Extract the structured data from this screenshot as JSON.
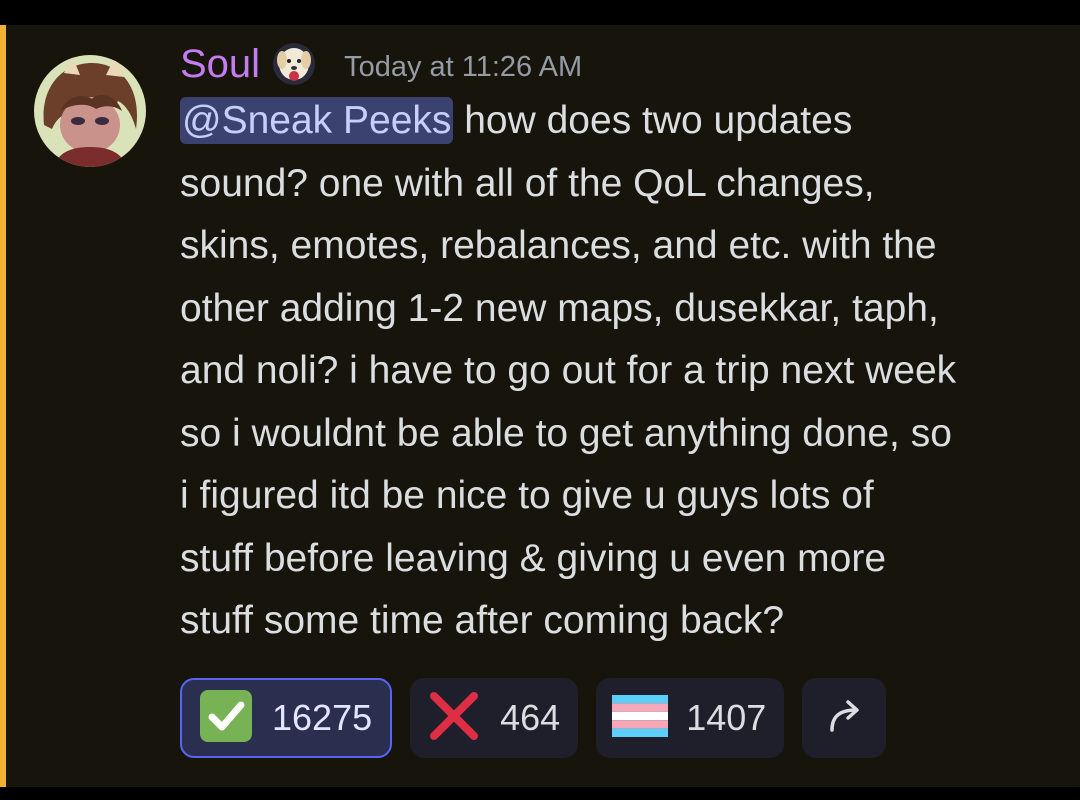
{
  "message": {
    "author": "Soul",
    "timestamp": "Today at 11:26 AM",
    "mention": "@Sneak Peeks",
    "lines": [
      " how does two updates",
      "sound? one with all of the QoL changes,",
      "skins, emotes, rebalances, and etc. with the",
      "other adding 1-2 new maps, dusekkar, taph,",
      "and noli? i have to go out for a trip next week",
      "so i wouldnt be able to get anything done, so",
      "i figured itd be nice to give u guys lots of",
      "stuff before leaving & giving u even more",
      "stuff some time after coming back?"
    ]
  },
  "reactions": [
    {
      "emoji": "white-check-mark-icon",
      "count": "16275",
      "selected": true
    },
    {
      "emoji": "x-mark-icon",
      "count": "464",
      "selected": false
    },
    {
      "emoji": "transgender-flag-icon",
      "count": "1407",
      "selected": false
    }
  ],
  "colors": {
    "username": "#c57cf0",
    "mention_bg": "#3c4270",
    "highlight_bar": "#f0b232",
    "message_bg": "#17140c",
    "selected_reaction_border": "#5865f2"
  },
  "icons": {
    "role_icon": "dog-icon",
    "share": "share-arrow-icon",
    "avatar": "user-avatar"
  }
}
